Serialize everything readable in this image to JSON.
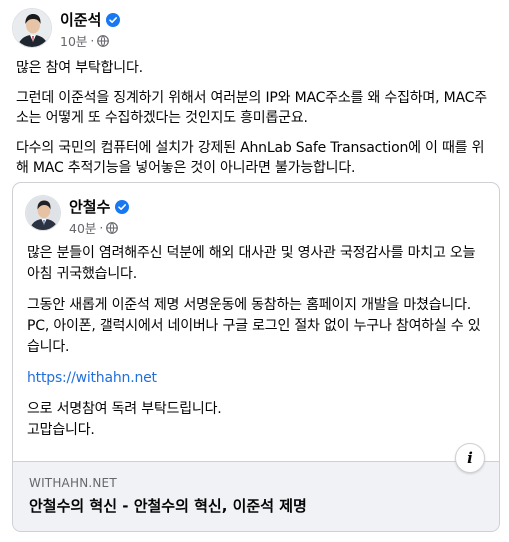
{
  "post": {
    "author": "이준석",
    "time": "10분",
    "paragraphs": [
      "많은 참여 부탁합니다.",
      "그런데 이준석을 징계하기 위해서 여러분의 IP와 MAC주소를 왜 수집하며, MAC주소는 어떻게 또 수집하겠다는 것인지도 흥미롭군요.",
      "다수의 국민의 컴퓨터에 설치가 강제된 AhnLab Safe Transaction에 이 때를 위해 MAC 추적기능을 넣어놓은 것이 아니라면 불가능합니다."
    ]
  },
  "shared": {
    "author": "안철수",
    "time": "40분",
    "paragraphs": [
      "많은 분들이 염려해주신 덕분에 해외 대사관 및 영사관 국정감사를 마치고 오늘 아침 귀국했습니다.",
      "그동안 새롭게 이준석 제명 서명운동에 동참하는 홈페이지 개발을 마쳤습니다.",
      "PC, 아이폰, 갤럭시에서 네이버나 구글 로그인 절차 없이 누구나 참여하실 수 있습니다."
    ],
    "link": "https://withahn.net",
    "closing_1": "으로 서명참여 독려 부탁드립니다.",
    "closing_2": "고맙습니다."
  },
  "preview": {
    "domain": "WITHAHN.NET",
    "title": "안철수의 혁신 - 안철수의 혁신, 이준석 제명",
    "info_icon": "i"
  },
  "icons": {
    "verified": "verified-badge-icon",
    "globe": "globe-icon"
  },
  "colors": {
    "link": "#216fdb",
    "verified": "#1877f2",
    "meta": "#65676b"
  }
}
